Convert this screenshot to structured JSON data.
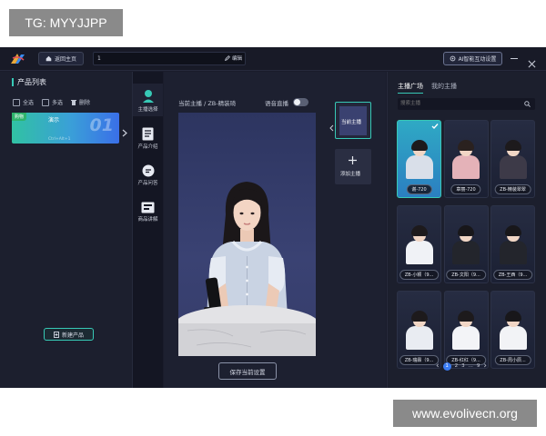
{
  "watermarks": {
    "top_left": "TG: MYYJJPP",
    "bottom_right": "www.evolivecn.org"
  },
  "topbar": {
    "back_label": "返回主页",
    "title_value": "1",
    "edit_label": "编辑",
    "ai_button_label": "AI智能互动设置"
  },
  "left": {
    "title": "产品列表",
    "select_all": "全选",
    "multi_select": "多选",
    "delete": "删除",
    "product": {
      "badge": "购物",
      "name": "演示",
      "number": "01",
      "subtitle": "Ctrl+Alt+1"
    },
    "new_product_label": "新建产品"
  },
  "nav": [
    {
      "label": "主播选择"
    },
    {
      "label": "产品介绍"
    },
    {
      "label": "产品问答"
    },
    {
      "label": "商品讲解"
    }
  ],
  "center": {
    "breadcrumb": "当前主播 / ZB-精装琦",
    "voice_label": "语音直播",
    "voice_on": false,
    "current_anchor_label": "当前主播",
    "add_anchor_label": "添加主播",
    "save_label": "保存当前设置"
  },
  "right": {
    "tab_active": "主播广场",
    "tab_other": "我的主播",
    "search_placeholder": "搜索主播",
    "anchors": [
      {
        "label": "谢-720",
        "selected": true
      },
      {
        "label": "章丽-720",
        "selected": false
      },
      {
        "label": "ZB-精装翠翠",
        "selected": false
      },
      {
        "label": "ZB-小颖（9...",
        "selected": false
      },
      {
        "label": "ZB-文阳（9...",
        "selected": false
      },
      {
        "label": "ZB-王西（9...",
        "selected": false
      },
      {
        "label": "ZB-瑞霖（9...",
        "selected": false
      },
      {
        "label": "ZB-红红（9...",
        "selected": false
      },
      {
        "label": "ZB-周小辰...",
        "selected": false
      }
    ],
    "pagination": {
      "prev": "‹",
      "pages": [
        "1",
        "2",
        "3",
        "...",
        "9"
      ],
      "current": "1",
      "next": "›"
    }
  },
  "colors": {
    "accent": "#37c9b6",
    "app_bg": "#1a1c2b",
    "primary_blue": "#3a7bf2"
  }
}
